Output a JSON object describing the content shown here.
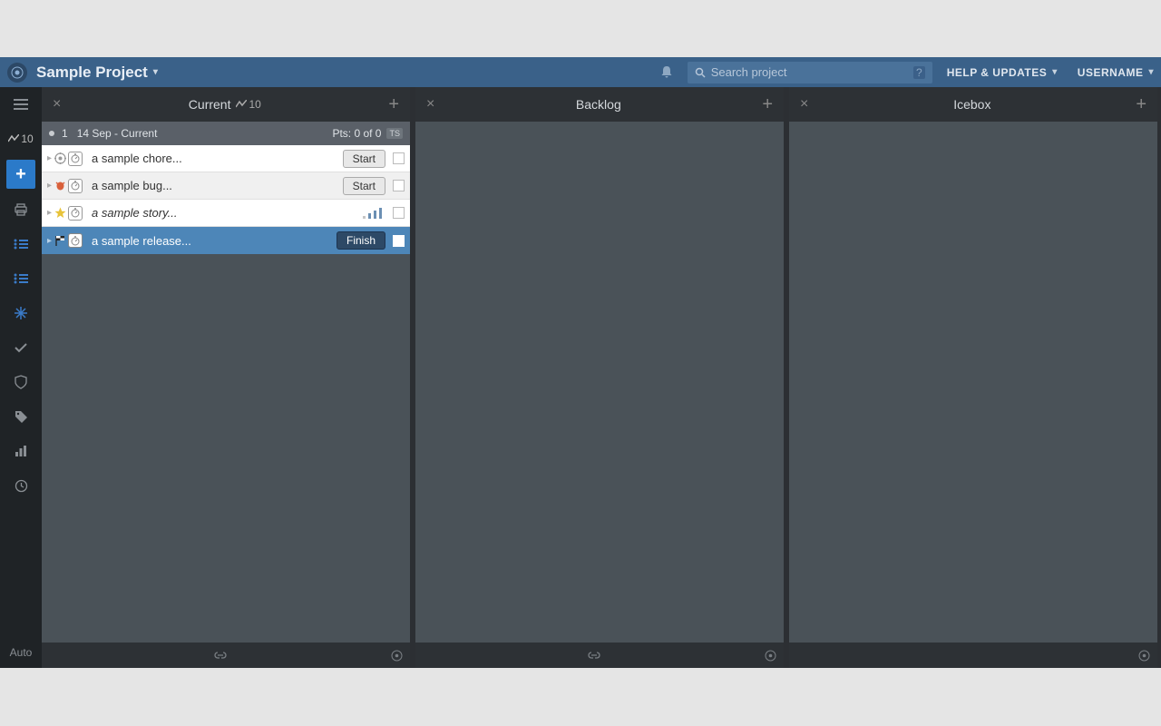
{
  "header": {
    "project_title": "Sample Project",
    "search_placeholder": "Search project",
    "help_label": "HELP & UPDATES",
    "username_label": "USERNAME"
  },
  "sidebar": {
    "velocity": "10",
    "auto_label": "Auto"
  },
  "panels": {
    "current": {
      "title": "Current",
      "velocity": "10",
      "iteration": {
        "num": "1",
        "date_range": "14 Sep - Current",
        "points": "Pts: 0 of 0",
        "badge": "TS"
      },
      "stories": [
        {
          "title": "a sample chore...",
          "button": "Start"
        },
        {
          "title": "a sample bug...",
          "button": "Start"
        },
        {
          "title": "a sample story..."
        },
        {
          "title": "a sample release...",
          "button": "Finish"
        }
      ]
    },
    "backlog": {
      "title": "Backlog"
    },
    "icebox": {
      "title": "Icebox"
    }
  }
}
